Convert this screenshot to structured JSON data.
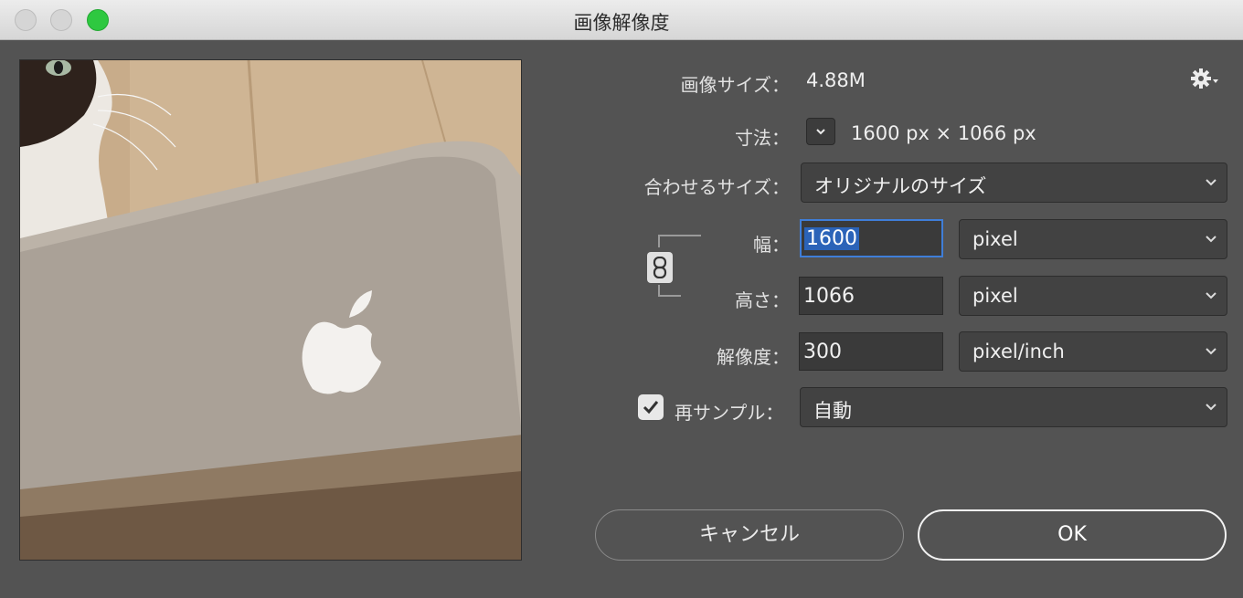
{
  "window": {
    "title": "画像解像度"
  },
  "image_size": {
    "label": "画像サイズ：",
    "value": "4.88M"
  },
  "dimensions": {
    "label": "寸法：",
    "value": "1600 px × 1066 px"
  },
  "fit_to": {
    "label": "合わせるサイズ：",
    "selected": "オリジナルのサイズ"
  },
  "width": {
    "label": "幅：",
    "value": "1600",
    "unit": "pixel"
  },
  "height": {
    "label": "高さ：",
    "value": "1066",
    "unit": "pixel"
  },
  "resolution": {
    "label": "解像度：",
    "value": "300",
    "unit": "pixel/inch"
  },
  "resample": {
    "label": "再サンプル：",
    "checked": true,
    "selected": "自動"
  },
  "buttons": {
    "cancel": "キャンセル",
    "ok": "OK"
  },
  "icons": {
    "settings": "gear-icon",
    "dims_toggle": "chevron-down-icon",
    "constrain": "link-icon",
    "select": "chevron-down-icon",
    "checkbox": "checkmark-icon"
  },
  "colors": {
    "dialog_bg": "#535353",
    "zoom_button": "#2ec840",
    "focus_ring": "#3f7ed8",
    "selection": "#2b63b8"
  }
}
